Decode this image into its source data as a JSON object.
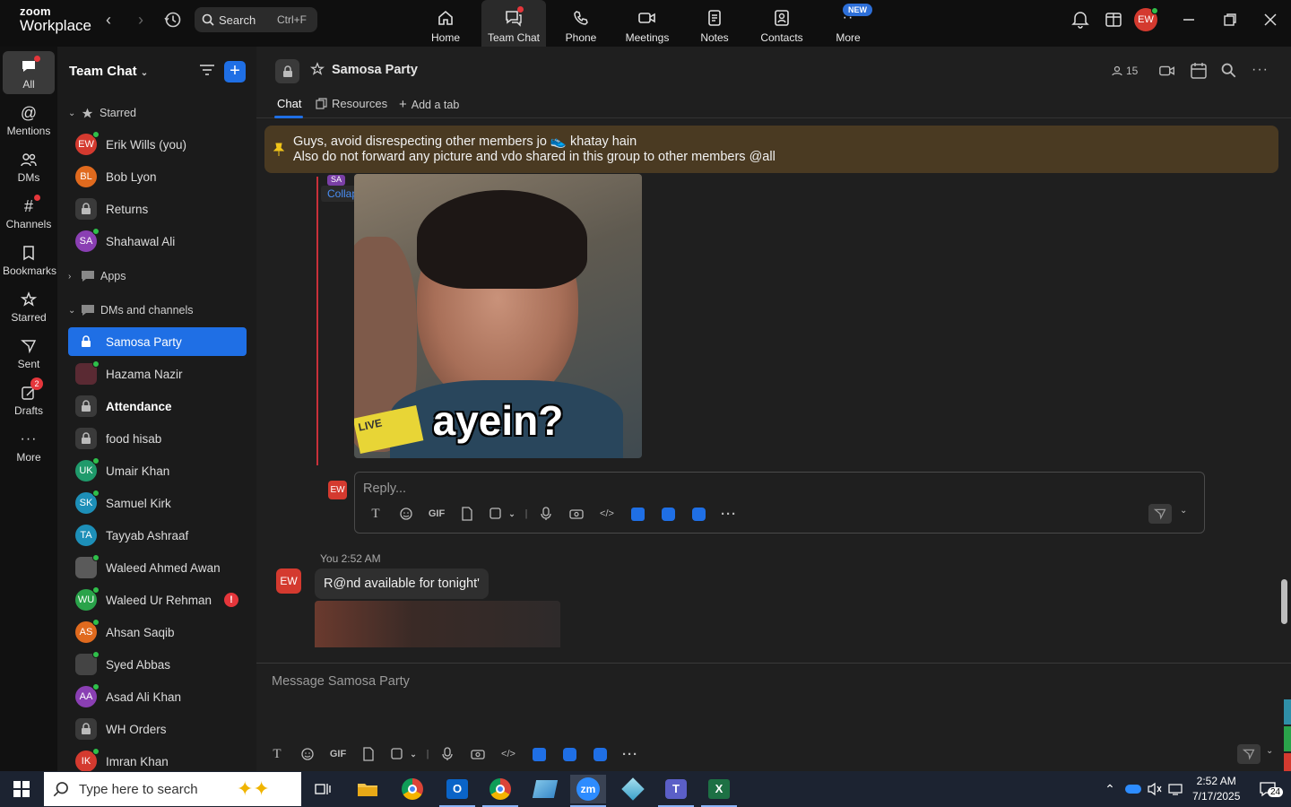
{
  "app": {
    "logo_line1": "zoom",
    "logo_line2": "Workplace",
    "search_label": "Search",
    "search_shortcut": "Ctrl+F",
    "user_initials": "EW"
  },
  "top_nav": [
    {
      "label": "Home",
      "icon": "home-icon"
    },
    {
      "label": "Team Chat",
      "icon": "chat-icon",
      "active": true
    },
    {
      "label": "Phone",
      "icon": "phone-icon"
    },
    {
      "label": "Meetings",
      "icon": "video-icon"
    },
    {
      "label": "Notes",
      "icon": "notes-icon"
    },
    {
      "label": "Contacts",
      "icon": "contacts-icon"
    },
    {
      "label": "More",
      "icon": "more-icon"
    }
  ],
  "new_badge": "NEW",
  "rail": [
    {
      "label": "All"
    },
    {
      "label": "Mentions"
    },
    {
      "label": "DMs"
    },
    {
      "label": "Channels"
    },
    {
      "label": "Bookmarks"
    },
    {
      "label": "Starred"
    },
    {
      "label": "Sent"
    },
    {
      "label": "Drafts",
      "badge": "2"
    },
    {
      "label": "More"
    }
  ],
  "sidebar": {
    "title": "Team Chat",
    "sections": {
      "starred": "Starred",
      "apps": "Apps",
      "dms": "DMs and channels"
    },
    "starred_items": [
      {
        "name": "Erik Wills (you)",
        "initials": "EW",
        "color": "#d43a2f"
      },
      {
        "name": "Bob Lyon",
        "initials": "BL",
        "color": "#e06a1e"
      },
      {
        "name": "Returns",
        "initials": "",
        "lock": true
      },
      {
        "name": "Shahawal Ali",
        "initials": "SA",
        "color": "#8a3fb3"
      }
    ],
    "dm_items": [
      {
        "name": "Samosa Party",
        "lock": true,
        "selected": true
      },
      {
        "name": "Hazama Nazir",
        "initials": "",
        "color": "#5a2a33"
      },
      {
        "name": "Attendance",
        "lock": true,
        "bold": true
      },
      {
        "name": "food hisab",
        "lock": true
      },
      {
        "name": "Umair Khan",
        "initials": "UK",
        "color": "#1f9a6b"
      },
      {
        "name": "Samuel Kirk",
        "initials": "SK",
        "color": "#1d8fb8"
      },
      {
        "name": "Tayyab Ashraaf",
        "initials": "TA",
        "color": "#1d8fb8"
      },
      {
        "name": "Waleed Ahmed Awan",
        "initials": "",
        "color": "#5a5a5a"
      },
      {
        "name": "Waleed Ur Rehman",
        "initials": "WU",
        "color": "#2aa34a",
        "alert": "!"
      },
      {
        "name": "Ahsan Saqib",
        "initials": "AS",
        "color": "#e06a1e"
      },
      {
        "name": "Syed Abbas",
        "initials": "",
        "color": "#444"
      },
      {
        "name": "Asad Ali Khan",
        "initials": "AA",
        "color": "#8a3fb3"
      },
      {
        "name": "WH Orders",
        "lock": true
      },
      {
        "name": "Imran Khan",
        "initials": "IK",
        "color": "#d43a2f"
      }
    ]
  },
  "channel": {
    "title": "Samosa Party",
    "members": "15",
    "tabs": [
      "Chat",
      "Resources",
      "Add a tab"
    ],
    "pinned_line1": "Guys, avoid disrespecting other members jo 👟 khatay hain",
    "pinned_line2": "Also do not forward any picture and vdo shared in this group to other members @all",
    "collapse_all": "Collapse all",
    "thread_avatar": "SA",
    "meme_caption": "ayein?",
    "meme_live": "LIVE",
    "reply_placeholder": "Reply...",
    "reply_avatar": "EW",
    "message_meta": "You 2:52 AM",
    "message_avatar": "EW",
    "message_text": "R@nd available for tonight'",
    "composer_placeholder": "Message Samosa Party",
    "toolbar_gif": "GIF"
  },
  "taskbar": {
    "search_placeholder": "Type here to search",
    "time": "2:52 AM",
    "date": "7/17/2025",
    "notification_count": "24"
  }
}
